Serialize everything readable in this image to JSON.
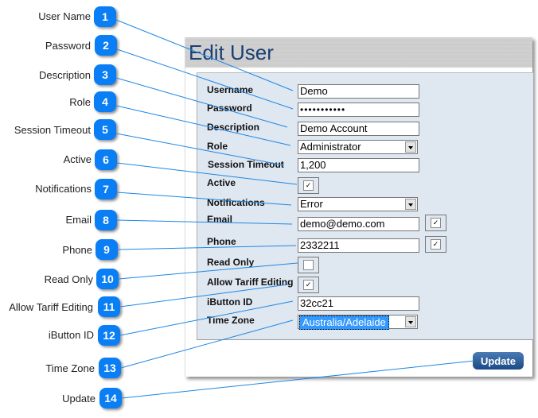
{
  "callouts": [
    {
      "number": "1",
      "label": "User Name"
    },
    {
      "number": "2",
      "label": "Password"
    },
    {
      "number": "3",
      "label": "Description"
    },
    {
      "number": "4",
      "label": "Role"
    },
    {
      "number": "5",
      "label": "Session Timeout"
    },
    {
      "number": "6",
      "label": "Active"
    },
    {
      "number": "7",
      "label": "Notifications"
    },
    {
      "number": "8",
      "label": "Email"
    },
    {
      "number": "9",
      "label": "Phone"
    },
    {
      "number": "10",
      "label": "Read Only"
    },
    {
      "number": "11",
      "label": "Allow Tariff Editing"
    },
    {
      "number": "12",
      "label": "iButton ID"
    },
    {
      "number": "13",
      "label": "Time Zone"
    },
    {
      "number": "14",
      "label": "Update"
    }
  ],
  "panel": {
    "title": "Edit User",
    "fields": {
      "username": {
        "label": "Username",
        "value": "Demo"
      },
      "password": {
        "label": "Password",
        "value": "•••••••••••"
      },
      "description": {
        "label": "Description",
        "value": "Demo Account"
      },
      "role": {
        "label": "Role",
        "value": "Administrator"
      },
      "session_timeout": {
        "label": "Session Timeout",
        "value": "1,200"
      },
      "active": {
        "label": "Active",
        "checked": true
      },
      "notifications": {
        "label": "Notifications",
        "value": "Error"
      },
      "email": {
        "label": "Email",
        "value": "demo@demo.com",
        "notify_checked": true
      },
      "phone": {
        "label": "Phone",
        "value": "2332211",
        "notify_checked": true
      },
      "read_only": {
        "label": "Read Only",
        "checked": false
      },
      "allow_tariff_editing": {
        "label": "Allow Tariff Editing",
        "checked": true
      },
      "ibutton_id": {
        "label": "iButton ID",
        "value": "32cc21"
      },
      "time_zone": {
        "label": "Time Zone",
        "value": "Australia/Adelaide"
      }
    },
    "update_label": "Update"
  },
  "colors": {
    "badge": "#0a7ef5",
    "connector": "#1e88e5",
    "title": "#1a3f73",
    "form_background": "#dfe7f1",
    "selection": "#3399ff"
  },
  "check_glyph": "✓"
}
